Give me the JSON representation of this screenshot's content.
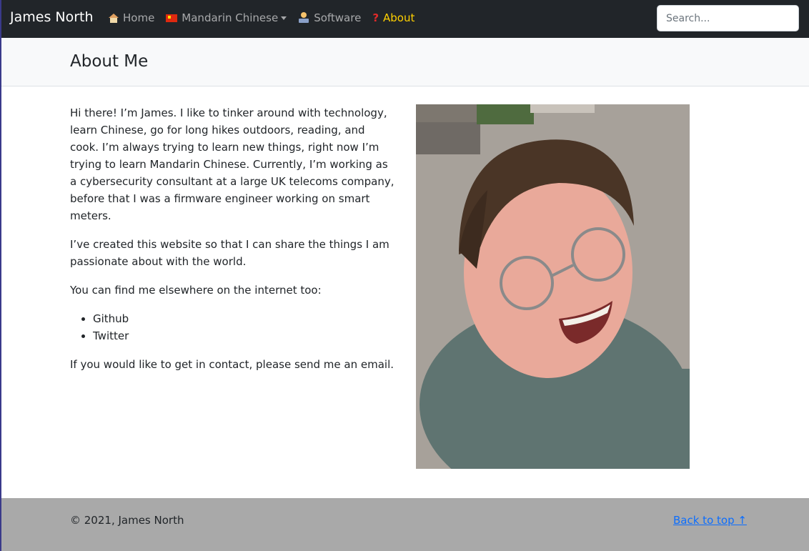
{
  "brand": {
    "name": "James North"
  },
  "nav": {
    "items": [
      {
        "label": "Home",
        "icon": "house-icon"
      },
      {
        "label": "Mandarin Chinese",
        "icon": "china-flag-icon"
      },
      {
        "label": "Software",
        "icon": "technologist-icon"
      },
      {
        "label": "About",
        "icon": "question-mark-icon"
      }
    ],
    "active_color": "#ffd000"
  },
  "search": {
    "placeholder": "Search..."
  },
  "page": {
    "title": "About Me"
  },
  "about": {
    "para1": "Hi there! I’m James. I like to tinker around with technology, learn Chinese, go for long hikes outdoors, reading, and cook. I’m always trying to learn new things, right now I’m trying to learn Mandarin Chinese. Currently, I’m working as a cybersecurity consultant at a large UK telecoms company, before that I was a firmware engineer working on smart meters.",
    "para2": "I’ve created this website so that I can share the things I am passionate about with the world.",
    "para3": "You can find me elsewhere on the internet too:",
    "links": [
      "Github",
      "Twitter"
    ],
    "para4": "If you would like to get in contact, please send me an email."
  },
  "footer": {
    "copyright": "© 2021, James North",
    "back_to_top": "Back to top ↑"
  },
  "colors": {
    "navbar_bg": "#212529",
    "footer_bg": "#a9a9a9",
    "link": "#0d6efd"
  }
}
